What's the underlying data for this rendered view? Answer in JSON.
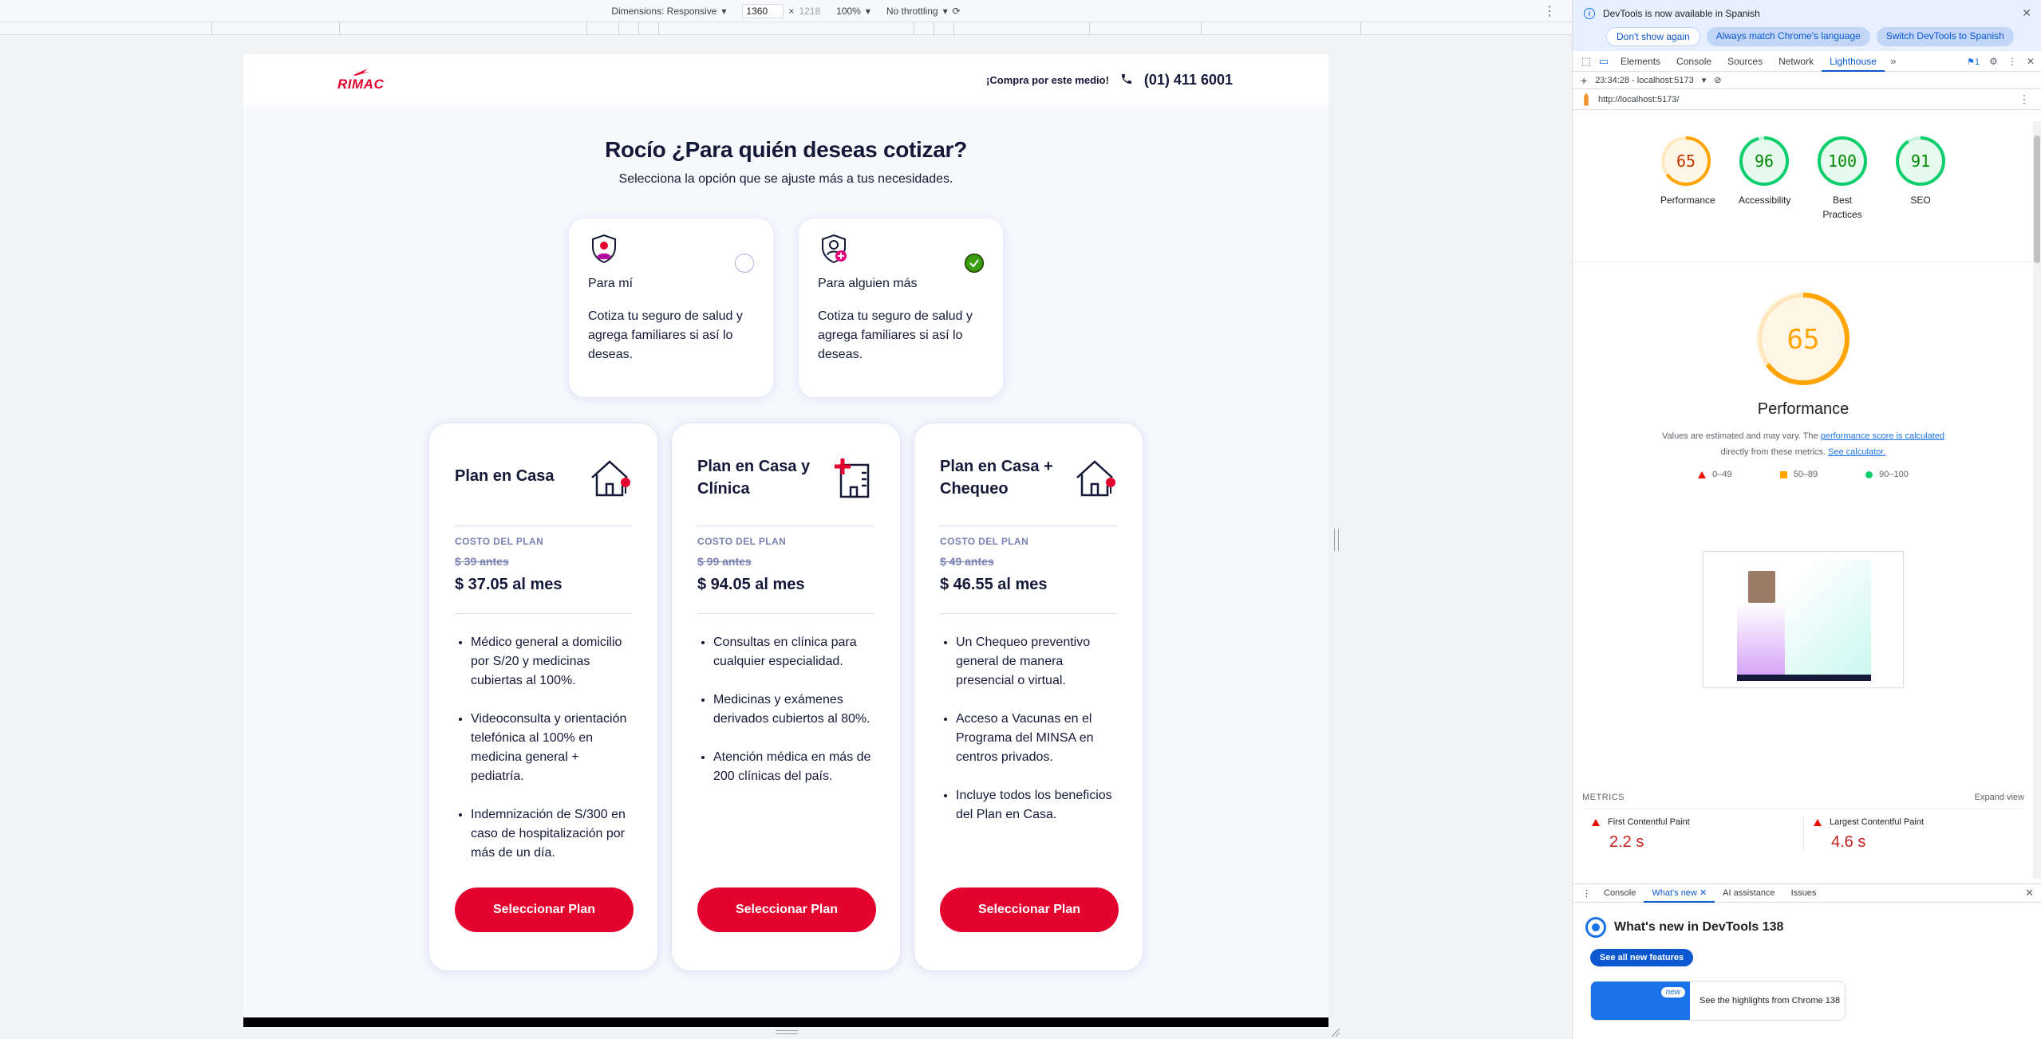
{
  "emulation": {
    "dimensions_label": "Dimensions: Responsive",
    "width": "1360",
    "times": "×",
    "height": "1218",
    "zoom": "100%",
    "throttling": "No throttling"
  },
  "site": {
    "brand": "RIMAC",
    "buy_text": "¡Compra por este medio!",
    "phone": "(01) 411 6001",
    "title": "Rocío ¿Para quién deseas cotizar?",
    "subtitle": "Selecciona la opción que se ajuste más a tus necesidades.",
    "options": [
      {
        "title": "Para mí",
        "desc": "Cotiza tu seguro de salud y agrega familiares si así lo deseas.",
        "selected": false
      },
      {
        "title": "Para alguien más",
        "desc": "Cotiza tu seguro de salud y agrega familiares si así lo deseas.",
        "selected": true
      }
    ],
    "plans": [
      {
        "name": "Plan en Casa",
        "cost_label": "COSTO DEL PLAN",
        "before": "$ 39 antes",
        "price": "$ 37.05 al mes",
        "benefits": [
          "Médico general a domicilio por S/20 y medicinas cubiertas al 100%.",
          "Videoconsulta y orientación telefónica al 100% en medicina general + pediatría.",
          "Indemnización de S/300 en caso de hospitalización por más de un día."
        ],
        "button": "Seleccionar Plan"
      },
      {
        "name": "Plan en Casa y Clínica",
        "cost_label": "COSTO DEL PLAN",
        "before": "$ 99 antes",
        "price": "$ 94.05 al mes",
        "benefits": [
          "Consultas en clínica para cualquier especialidad.",
          "Medicinas y exámenes derivados cubiertos al 80%.",
          "Atención médica en más de 200 clínicas del país."
        ],
        "button": "Seleccionar Plan"
      },
      {
        "name": "Plan en Casa + Chequeo",
        "cost_label": "COSTO DEL PLAN",
        "before": "$ 49 antes",
        "price": "$ 46.55 al mes",
        "benefits": [
          "Un Chequeo preventivo general de manera presencial o virtual.",
          "Acceso a Vacunas en el Programa del MINSA en centros privados.",
          "Incluye todos los beneficios del Plan en Casa."
        ],
        "button": "Seleccionar Plan"
      }
    ]
  },
  "devtools": {
    "info_message": "DevTools is now available in Spanish",
    "info_buttons": [
      "Don't show again",
      "Always match Chrome's language",
      "Switch DevTools to Spanish"
    ],
    "tabs": [
      "Elements",
      "Console",
      "Sources",
      "Network",
      "Lighthouse"
    ],
    "issues_badge": "1",
    "report_time": "23:34:28 - localhost:5173",
    "url": "http://localhost:5173/",
    "scores": [
      {
        "value": 65,
        "label": "Performance",
        "color": "#ffa400"
      },
      {
        "value": 96,
        "label": "Accessibility",
        "color": "#0cce6b"
      },
      {
        "value": 100,
        "label": "Best Practices",
        "color": "#0cce6b"
      },
      {
        "value": 91,
        "label": "SEO",
        "color": "#0cce6b"
      }
    ],
    "perf": {
      "score": 65,
      "title": "Performance",
      "note_prefix": "Values are estimated and may vary. The",
      "note_link": "performance score is calculated",
      "note_mid": "directly from these metrics.",
      "note_link2": "See calculator.",
      "legend": [
        "0–49",
        "50–89",
        "90–100"
      ]
    },
    "metrics": {
      "heading": "METRICS",
      "expand": "Expand view",
      "items": [
        {
          "name": "First Contentful Paint",
          "value": "2.2 s"
        },
        {
          "name": "Largest Contentful Paint",
          "value": "4.6 s"
        }
      ]
    },
    "drawer_tabs": [
      "Console",
      "What's new",
      "AI assistance",
      "Issues"
    ],
    "whats_new": {
      "title": "What's new in DevTools 138",
      "button": "See all new features",
      "badge": "new",
      "highlight": "See the highlights from Chrome 138"
    }
  }
}
